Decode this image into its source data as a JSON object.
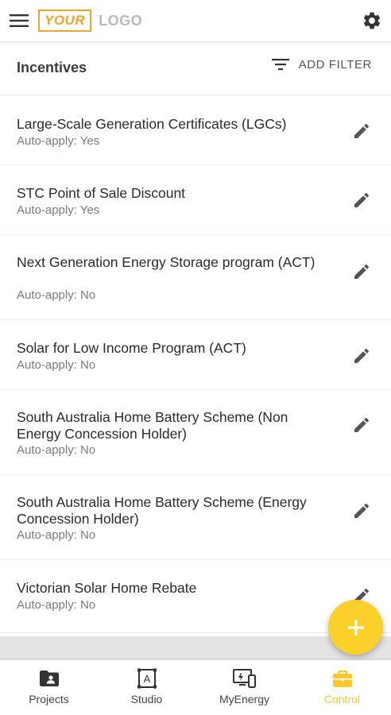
{
  "app": {
    "logo_box": "YOUR",
    "logo_text": "LOGO"
  },
  "header": {
    "title": "Incentives",
    "add_filter_label": "ADD FILTER"
  },
  "incentives": [
    {
      "title": "Large-Scale Generation Certificates (LGCs)",
      "subtitle": "Auto-apply: Yes"
    },
    {
      "title": "STC Point of Sale Discount",
      "subtitle": "Auto-apply: Yes"
    },
    {
      "title": "Next Generation Energy Storage program (ACT)",
      "subtitle": "Auto-apply: No"
    },
    {
      "title": "Solar for Low Income Program (ACT)",
      "subtitle": "Auto-apply: No"
    },
    {
      "title": "South Australia Home Battery Scheme (Non Energy Concession Holder)",
      "subtitle": "Auto-apply: No"
    },
    {
      "title": "South Australia Home Battery Scheme (Energy Concession Holder)",
      "subtitle": "Auto-apply: No"
    },
    {
      "title": "Victorian Solar Home Rebate",
      "subtitle": "Auto-apply: No"
    }
  ],
  "bottom_nav": [
    {
      "label": "Projects",
      "icon": "folder-person-icon",
      "active": false
    },
    {
      "label": "Studio",
      "icon": "studio-icon",
      "active": false
    },
    {
      "label": "MyEnergy",
      "icon": "monitor-energy-icon",
      "active": false
    },
    {
      "label": "Control",
      "icon": "briefcase-icon",
      "active": true
    }
  ],
  "colors": {
    "accent": "#fcd02a",
    "logo_orange": "#f0a32a",
    "active_nav": "#fcc72c"
  }
}
